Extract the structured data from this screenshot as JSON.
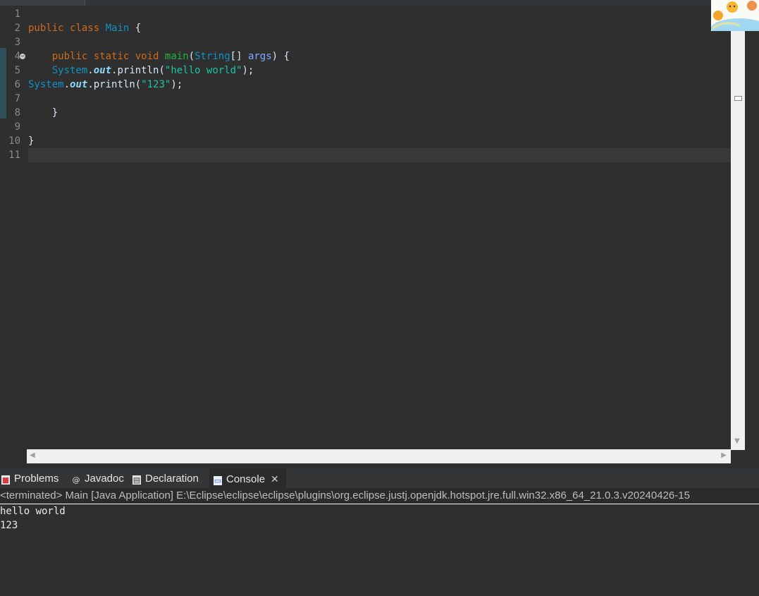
{
  "editor": {
    "lines": [
      {
        "num": "1",
        "tokens": []
      },
      {
        "num": "2",
        "tokens": [
          {
            "t": "public",
            "c": "kw"
          },
          {
            "t": " ",
            "c": "plain"
          },
          {
            "t": "class",
            "c": "kw"
          },
          {
            "t": " ",
            "c": "plain"
          },
          {
            "t": "Main",
            "c": "cls"
          },
          {
            "t": " {",
            "c": "plain"
          }
        ]
      },
      {
        "num": "3",
        "tokens": []
      },
      {
        "num": "4",
        "fold": true,
        "tokens": [
          {
            "t": "    ",
            "c": "plain"
          },
          {
            "t": "public",
            "c": "kw"
          },
          {
            "t": " ",
            "c": "plain"
          },
          {
            "t": "static",
            "c": "kw"
          },
          {
            "t": " ",
            "c": "plain"
          },
          {
            "t": "void",
            "c": "kw"
          },
          {
            "t": " ",
            "c": "plain"
          },
          {
            "t": "main",
            "c": "method"
          },
          {
            "t": "(",
            "c": "plain"
          },
          {
            "t": "String",
            "c": "cls"
          },
          {
            "t": "[] ",
            "c": "plain"
          },
          {
            "t": "args",
            "c": "param"
          },
          {
            "t": ") {",
            "c": "plain"
          }
        ]
      },
      {
        "num": "5",
        "tokens": [
          {
            "t": "    ",
            "c": "plain"
          },
          {
            "t": "System",
            "c": "cls"
          },
          {
            "t": ".",
            "c": "plain"
          },
          {
            "t": "out",
            "c": "fld"
          },
          {
            "t": ".println(",
            "c": "plain"
          },
          {
            "t": "\"hello world\"",
            "c": "str"
          },
          {
            "t": ");",
            "c": "plain"
          }
        ]
      },
      {
        "num": "6",
        "tokens": [
          {
            "t": "System",
            "c": "cls"
          },
          {
            "t": ".",
            "c": "plain"
          },
          {
            "t": "out",
            "c": "fld"
          },
          {
            "t": ".println(",
            "c": "plain"
          },
          {
            "t": "\"123\"",
            "c": "str"
          },
          {
            "t": ");",
            "c": "plain"
          }
        ]
      },
      {
        "num": "7",
        "tokens": []
      },
      {
        "num": "8",
        "tokens": [
          {
            "t": "    }",
            "c": "plain"
          }
        ]
      },
      {
        "num": "9",
        "tokens": []
      },
      {
        "num": "10",
        "tokens": [
          {
            "t": "}",
            "c": "plain"
          }
        ]
      },
      {
        "num": "11",
        "current": true,
        "tokens": []
      }
    ]
  },
  "views": {
    "tabs": [
      {
        "label": "Problems",
        "icon": "problems-icon",
        "active": false
      },
      {
        "label": "Javadoc",
        "icon": "javadoc-icon",
        "active": false
      },
      {
        "label": "Declaration",
        "icon": "declaration-icon",
        "active": false
      },
      {
        "label": "Console",
        "icon": "console-icon",
        "active": true
      }
    ],
    "close_glyph": "✕"
  },
  "console": {
    "description": "<terminated> Main [Java Application] E:\\Eclipse\\eclipse\\eclipse\\plugins\\org.eclipse.justj.openjdk.hotspot.jre.full.win32.x86_64_21.0.3.v20240426-15",
    "output": [
      "hello world",
      "123"
    ]
  },
  "colors": {
    "keyword": "#cc6c1d",
    "class": "#1290c3",
    "static_field": "#8dd9fc",
    "method": "#1eb540",
    "string": "#17c6a3",
    "background": "#2f2f2f"
  }
}
